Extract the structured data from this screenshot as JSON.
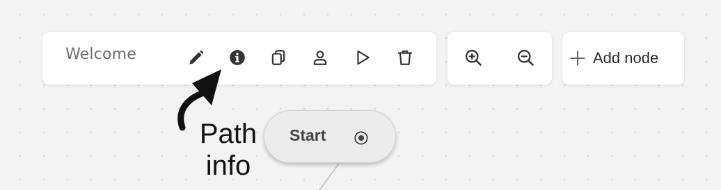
{
  "path_toolbar": {
    "path_name": "Welcome",
    "buttons": [
      {
        "icon": "pencil-icon",
        "action": "edit-path"
      },
      {
        "icon": "info-icon",
        "action": "path-info"
      },
      {
        "icon": "copy-icon",
        "action": "duplicate-path"
      },
      {
        "icon": "user-icon",
        "action": "path-users"
      },
      {
        "icon": "play-icon",
        "action": "run-path"
      },
      {
        "icon": "trash-icon",
        "action": "delete-path"
      }
    ]
  },
  "zoom_toolbar": {
    "buttons": [
      {
        "icon": "zoom-in-icon"
      },
      {
        "icon": "zoom-out-icon"
      }
    ]
  },
  "add_toolbar": {
    "icon": "plus-icon",
    "label": "Add node"
  },
  "start_node": {
    "label": "Start",
    "icon": "radio-target-icon"
  },
  "annotation": {
    "line1": "Path",
    "line2": "info"
  },
  "colors": {
    "canvas": "#f3f3f3",
    "toolbar": "#ffffff",
    "icon": "#333333",
    "node": "#ececec"
  }
}
